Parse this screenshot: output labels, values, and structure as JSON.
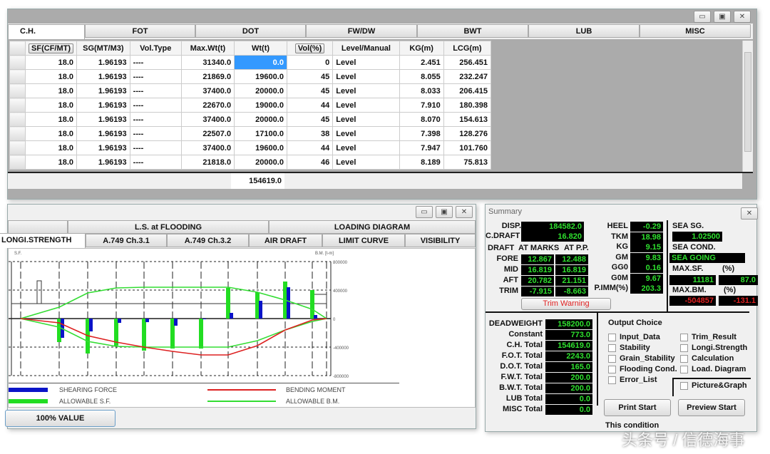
{
  "top_window": {
    "tabs": [
      "C.H.",
      "FOT",
      "DOT",
      "FW/DW",
      "BWT",
      "LUB",
      "MISC"
    ],
    "columns": [
      "SF(CF/MT)",
      "SG(MT/M3)",
      "Vol.Type",
      "Max.Wt(t)",
      "Wt(t)",
      "Vol(%)",
      "Level/Manual",
      "KG(m)",
      "LCG(m)"
    ],
    "rows": [
      [
        "18.0",
        "1.96193",
        "----",
        "31340.0",
        "0.0",
        "0",
        "Level",
        "2.451",
        "256.451"
      ],
      [
        "18.0",
        "1.96193",
        "----",
        "21869.0",
        "19600.0",
        "45",
        "Level",
        "8.055",
        "232.247"
      ],
      [
        "18.0",
        "1.96193",
        "----",
        "37400.0",
        "20000.0",
        "45",
        "Level",
        "8.033",
        "206.415"
      ],
      [
        "18.0",
        "1.96193",
        "----",
        "22670.0",
        "19000.0",
        "44",
        "Level",
        "7.910",
        "180.398"
      ],
      [
        "18.0",
        "1.96193",
        "----",
        "37400.0",
        "20000.0",
        "45",
        "Level",
        "8.070",
        "154.613"
      ],
      [
        "18.0",
        "1.96193",
        "----",
        "22507.0",
        "17100.0",
        "38",
        "Level",
        "7.398",
        "128.276"
      ],
      [
        "18.0",
        "1.96193",
        "----",
        "37400.0",
        "19600.0",
        "44",
        "Level",
        "7.947",
        "101.760"
      ],
      [
        "18.0",
        "1.96193",
        "----",
        "21818.0",
        "20000.0",
        "46",
        "Level",
        "8.189",
        "75.813"
      ]
    ],
    "total_wt": "154619.0"
  },
  "strength_window": {
    "tabs_row1": [
      "",
      "L.S. at FLOODING",
      "LOADING DIAGRAM"
    ],
    "tabs_row2": [
      "LONGI.STRENGTH",
      "A.749 Ch.3.1",
      "A.749 Ch.3.2",
      "AIR DRAFT",
      "LIMIT CURVE",
      "VISIBILITY"
    ],
    "value_button": "100% VALUE",
    "legend": {
      "sf": "SHEARING FORCE",
      "asf": "ALLOWABLE S.F.",
      "bm": "BENDING MOMENT",
      "abm": "ALLOWABLE B.M."
    },
    "colors": {
      "sf": "#0a14c8",
      "asf": "#22dd22",
      "bm": "#dd2020",
      "abm": "#33dd33"
    }
  },
  "chart_data": {
    "type": "bar+line",
    "left_label": "S.F.",
    "right_label": "B.M. [t-m]",
    "right_ticks": [
      "800000",
      "400000",
      "0",
      "-400000",
      "-800000"
    ],
    "ylim": [
      -800000,
      800000
    ],
    "series": [
      {
        "name": "SHEARING FORCE",
        "values": [
          -270000,
          -180000,
          -60000,
          -50000,
          -100000,
          -10000,
          80000,
          250000,
          440000,
          50000
        ]
      },
      {
        "name": "ALLOWABLE S.F.",
        "values": [
          -330000,
          -490000,
          -380000,
          -450000,
          -420000,
          -420000,
          430000,
          370000,
          520000,
          400000
        ]
      },
      {
        "name": "BENDING MOMENT",
        "values": [
          0,
          -60000,
          -240000,
          -330000,
          -400000,
          -460000,
          -510000,
          -510000,
          -380000,
          -160000,
          -20000,
          0
        ]
      },
      {
        "name": "ALLOWABLE B.M.",
        "upper": [
          0,
          160000,
          360000,
          430000,
          440000,
          440000,
          440000,
          440000,
          370000,
          260000,
          130000,
          0
        ],
        "lower": [
          0,
          -120000,
          -320000,
          -390000,
          -400000,
          -400000,
          -400000,
          -400000,
          -310000,
          -160000,
          -40000,
          0
        ]
      }
    ]
  },
  "summary": {
    "title": "Summary",
    "disp_label": "DISP.",
    "disp": "184582.0",
    "cdraft_label": "C.DRAFT",
    "cdraft": "16.820",
    "draft_label": "DRAFT",
    "at_marks": "AT MARKS",
    "at_pp": "AT P.P.",
    "drafts": [
      [
        "FORE",
        "12.867",
        "12.488"
      ],
      [
        "MID",
        "16.819",
        "16.819"
      ],
      [
        "AFT",
        "20.782",
        "21.151"
      ],
      [
        "TRIM",
        "-7.915",
        "-8.663"
      ]
    ],
    "stab": [
      [
        "HEEL",
        "-0.29"
      ],
      [
        "TKM",
        "18.98"
      ],
      [
        "KG",
        "9.15"
      ],
      [
        "GM",
        "9.83"
      ],
      [
        "GG0",
        "0.16"
      ],
      [
        "G0M",
        "9.67"
      ],
      [
        "P.IMM(%)",
        "203.3"
      ]
    ],
    "trim_warning": "Trim Warning",
    "sea_sg_label": "SEA SG.",
    "sea_sg": "1.02500",
    "sea_cond_label": "SEA COND.",
    "sea_cond": "SEA GOING",
    "max_sf_label": "MAX.SF.",
    "pct": "(%)",
    "max_sf": "11181",
    "max_sf_pct": "87.0",
    "max_bm_label": "MAX.BM.",
    "max_bm": "-504857",
    "max_bm_pct": "-131.1",
    "totals": [
      [
        "DEADWEIGHT",
        "158200.0"
      ],
      [
        "Constant",
        "773.0"
      ],
      [
        "C.H. Total",
        "154619.0"
      ],
      [
        "F.O.T. Total",
        "2243.0"
      ],
      [
        "D.O.T. Total",
        "165.0"
      ],
      [
        "F.W.T. Total",
        "200.0"
      ],
      [
        "B.W.T. Total",
        "200.0"
      ],
      [
        "LUB Total",
        "0.0"
      ],
      [
        "MISC Total",
        "0.0"
      ]
    ],
    "output_choice": "Output Choice",
    "options_left": [
      "Input_Data",
      "Stability",
      "Grain_Stability",
      "Flooding Cond.",
      "Error_List"
    ],
    "options_right": [
      "Trim_Result",
      "Longi.Strength",
      "Calculation",
      "Load. Diagram"
    ],
    "picture_graph": "Picture&Graph",
    "print": "Print Start",
    "preview": "Preview Start",
    "status": "This condition"
  },
  "watermark": "头条号 / 信德海事",
  "colors": {
    "lcd_bg": "#000000",
    "lcd_text": "#2ee02e",
    "lcd_alert": "#e02020"
  }
}
